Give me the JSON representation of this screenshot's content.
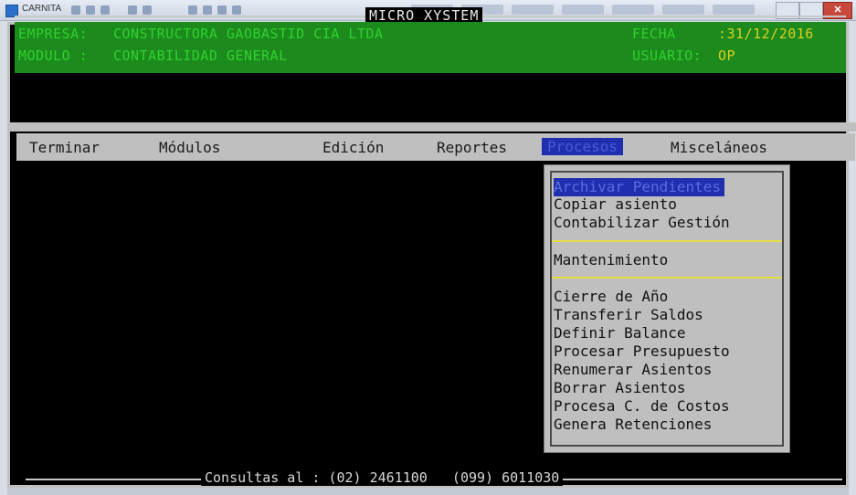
{
  "window": {
    "title": "CARNITA",
    "close_label": "✕"
  },
  "header": {
    "system_title": "MICRO XYSTEM",
    "empresa_label": "EMPRESA:",
    "empresa_value": "CONSTRUCTORA GAOBASTID CIA LTDA",
    "modulo_label": "MODULO  :",
    "modulo_value": "CONTABILIDAD GENERAL",
    "fecha_label": "FECHA",
    "fecha_value": ":31/12/2016",
    "usuario_label": "USUARIO:",
    "usuario_value": "OP"
  },
  "menu": {
    "items": [
      "Terminar",
      "Módulos",
      "Edición",
      "Reportes",
      "Procesos",
      "Misceláneos"
    ],
    "active": "Procesos"
  },
  "dropdown": {
    "group1": [
      "Archivar Pendientes",
      "Copiar asiento",
      "Contabilizar Gestión"
    ],
    "group2": [
      "Mantenimiento"
    ],
    "group3": [
      "Cierre de Año",
      "Transferir Saldos",
      "Definir Balance",
      "Procesar Presupuesto",
      "Renumerar Asientos",
      "Borrar Asientos",
      "Procesa C. de Costos",
      "Genera Retenciones"
    ],
    "selected": "Archivar Pendientes"
  },
  "footer": {
    "text": "Consultas al : (02) 2461100   (099) 6011030"
  },
  "colors": {
    "console_bg": "#000000",
    "panel_green": "#1d8a1d",
    "text_green": "#2ed22e",
    "menu_gray": "#bfbfbf",
    "highlight_blue": "#1f2fb0",
    "separator_yellow": "#e6de46"
  }
}
